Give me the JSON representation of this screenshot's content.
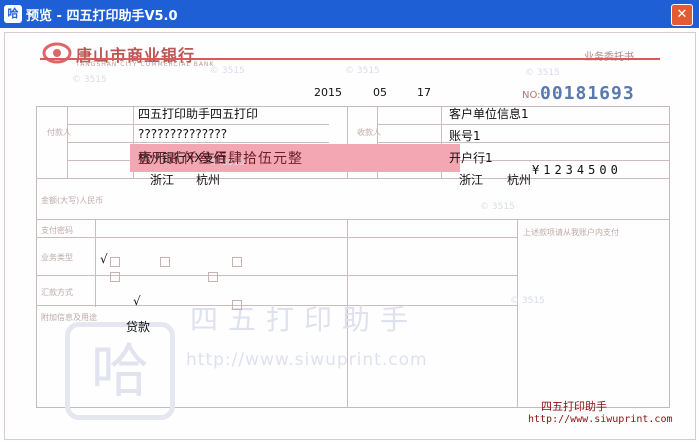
{
  "window": {
    "title": "预览 - 四五打印助手V5.0",
    "close_glyph": "✕"
  },
  "bank": {
    "name": "唐山市商业银行",
    "subtitle": "TANGSHAN CITY COMMERCIAL BANK",
    "doc_type": "业务委托书"
  },
  "date": {
    "year": "2015",
    "month": "05",
    "day": "17"
  },
  "serial": {
    "prefix": "NO:",
    "number": "00181693"
  },
  "payer": {
    "name": "四五打印助手四五打印",
    "account": "??????????????",
    "bank": "杭州银行XX支行",
    "province": "浙江",
    "city": "杭州"
  },
  "payee": {
    "name": "客户单位信息1",
    "account": "账号1",
    "bank": "开户行1",
    "province": "浙江",
    "city": "杭州"
  },
  "amount": {
    "capital": "壹万贰仟叁佰肆拾伍元整",
    "numeric": "¥1234500"
  },
  "business": {
    "check1": "√",
    "check2": "√"
  },
  "purpose": "贷款",
  "watermark": {
    "text": "四五打印助手",
    "url": "http://www.siwuprint.com"
  },
  "footer": {
    "name": "四五打印助手",
    "url": "http://www.siwuprint.com"
  }
}
